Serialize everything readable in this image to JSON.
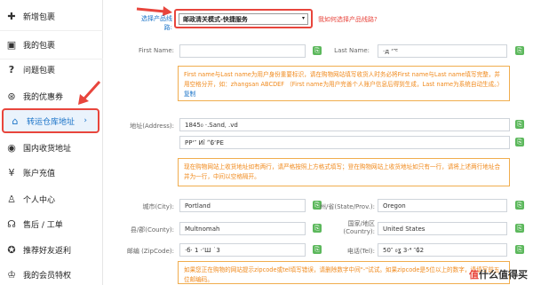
{
  "sidebar": {
    "items": [
      {
        "label": "新增包裹",
        "icon": "plus-icon"
      },
      {
        "label": "我的包裹",
        "icon": "package-icon"
      },
      {
        "label": "问题包裹",
        "icon": "question-icon"
      },
      {
        "label": "我的优惠券",
        "icon": "coupon-icon"
      },
      {
        "label": "转运仓库地址",
        "icon": "home-icon",
        "active": true
      },
      {
        "label": "国内收货地址",
        "icon": "location-icon"
      },
      {
        "label": "账户充值",
        "icon": "yen-icon"
      },
      {
        "label": "个人中心",
        "icon": "person-icon"
      },
      {
        "label": "售后 / 工单",
        "icon": "headset-icon"
      },
      {
        "label": "推荐好友返利",
        "icon": "share-icon"
      },
      {
        "label": "我的会员特权",
        "icon": "vip-icon"
      }
    ]
  },
  "service": {
    "label": "选择产品线路:",
    "value": "邮政清关模式-快捷服务",
    "help_link": "我如何选择产品线路?"
  },
  "form": {
    "first_name_label": "First Name:",
    "first_name_value": "",
    "last_name_label": "Last Name:",
    "last_name_value": "·д  ‘″ᴱ",
    "name_note": "First name与Last name为用户身份重要标识，请在购物网站填写收货人时务必将First name与Last name填写完整，并用空格分开，如：zhangsan ABCDEF （First name为用户完善个人账户信息后得到生成，Last name为系统自动生成。）",
    "name_note_link": "复制",
    "address_label": "地址(Address):",
    "address_line1": "1845₀  ·.Sandˌ    .vd",
    "address_line2": "PP‘″ Иî  ˮ₲‘PE",
    "address_note": "现在购物网站上收货地址如有两行，请严格按照上方格式填写；登在购物网站上收货地址如只有一行，请将上述两行地址合并为一行，中间以空格隔开。",
    "city_label": "城市(City):",
    "city_value": "Portland",
    "state_label": "州/省(State/Prov.):",
    "state_value": "Oregon",
    "county_label": "县/郡(County):",
    "county_value": "Multnomah",
    "country_label": "国家/地区(Country):",
    "country_value": "United States",
    "zip_label": "邮编 (ZipCode):",
    "zip_value": "·б· 1 ·‘Ш  ˙3",
    "tel_label": "电话(Tel):",
    "tel_value": "50″ ₀ʓ 3·⁴  ″₲2",
    "zip_note": "如果您正在购物的网站提示zipcode或tel填写错误，请删除数字中间\"-\"试试。如果zipcode是5位以上的数字，请填写前五位邮编码。"
  },
  "watermark": {
    "part1": "值",
    "part2": "什么值得买"
  }
}
